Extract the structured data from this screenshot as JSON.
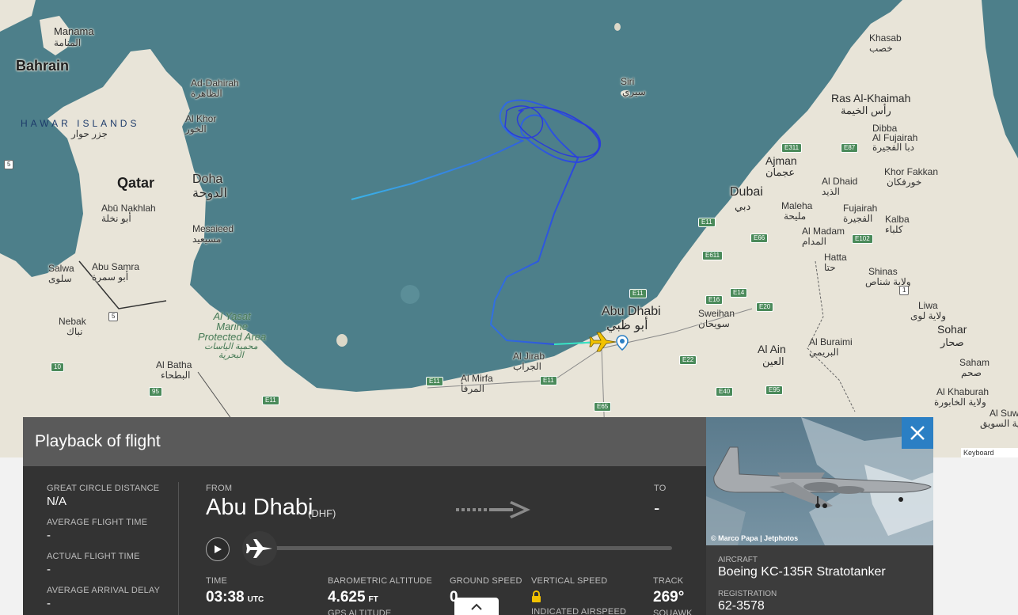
{
  "map": {
    "labels": {
      "manama": "Manama",
      "manama_ar": "المنامة",
      "bahrain": "Bahrain",
      "hawar": "HAWAR ISLANDS",
      "hawar_ar": "جزر حوار",
      "ad_dahirah": "Ad-Dahirah",
      "ad_dahirah_ar": "الظاهرة",
      "al_khor": "Al Khor",
      "al_khor_ar": "الخور",
      "qatar": "Qatar",
      "doha": "Doha",
      "doha_ar": "الدوحة",
      "abu_nakhlah": "Abū Nakhlah",
      "abu_nakhlah_ar": "أبو نخلة",
      "mesaieed": "Mesaieed",
      "mesaieed_ar": "مسيعيد",
      "salwa": "Salwa",
      "salwa_ar": "سلوى",
      "abu_samra": "Abu Samra",
      "abu_samra_ar": "أبو سمرة",
      "nebak": "Nebak",
      "nebak_ar": "نباك",
      "al_yasat": "Al Yasat\nMarine\nProtected Area",
      "al_yasat_ar": "محمية الياسات\nالبحرية",
      "al_batha": "Al Batha",
      "al_batha_ar": "البطحاء",
      "siri": "Siri",
      "siri_ar": "سيري",
      "khasab": "Khasab",
      "khasab_ar": "خصب",
      "ras_al_khaimah": "Ras Al-Khaimah",
      "ras_al_khaimah_ar": "رأس الخيمة",
      "dibba": "Dibba",
      "dibba_ar": "دبا",
      "al_fujairah": "Al Fujairah",
      "al_fujairah_ar": "دبا الفجيرة",
      "ajman": "Ajman",
      "ajman_ar": "عجمان",
      "khor_fakkan": "Khor Fakkan",
      "khor_fakkan_ar": "خورفكان",
      "dubai": "Dubai",
      "dubai_ar": "دبي",
      "al_dhaid": "Al Dhaid",
      "al_dhaid_ar": "الذيد",
      "maleha": "Maleha",
      "maleha_ar": "مليحة",
      "fujairah": "Fujairah",
      "fujairah_ar": "الفجيرة",
      "kalba": "Kalba",
      "kalba_ar": "كلباء",
      "al_madam": "Al Madam",
      "al_madam_ar": "المدام",
      "hatta": "Hatta",
      "hatta_ar": "حتا",
      "shinas": "Shinas",
      "shinas_ar": "ولاية شناص",
      "abu_dhabi": "Abu Dhabi",
      "abu_dhabi_ar": "أبو ظبي",
      "sweihan": "Sweihan",
      "sweihan_ar": "سويحان",
      "liwa": "Liwa",
      "liwa_ar": "ولاية لوى",
      "sohar": "Sohar",
      "sohar_ar": "صحار",
      "al_ain": "Al Ain",
      "al_ain_ar": "العين",
      "al_buraimi": "Al Buraimi",
      "al_buraimi_ar": "البريمي",
      "saham": "Saham",
      "saham_ar": "صحم",
      "al_jirab": "Al Jirab",
      "al_jirab_ar": "الجراب",
      "al_mirfa": "Al Mirfa",
      "al_mirfa_ar": "المرفأ",
      "al_khaburah": "Al Khaburah",
      "al_khaburah_ar": "ولاية الخابورة",
      "al_suw": "Al Suw",
      "al_suw_ar": "ولاية السويق"
    },
    "roads": {
      "r5a": "5",
      "r5b": "5",
      "r10": "10",
      "r95": "95",
      "e11a": "E11",
      "e11b": "E11",
      "e11c": "E11",
      "e11d": "E11",
      "e11e": "E11",
      "e311": "E311",
      "e87": "E87",
      "e611": "E611",
      "e66": "E66",
      "e16": "E16",
      "e14": "E14",
      "e20": "E20",
      "e22": "E22",
      "e40": "E40",
      "e95": "E95",
      "e65": "E65",
      "e102": "E102",
      "r1": "1"
    },
    "keyboard_shortcuts": "Keyboard shortcuts"
  },
  "panel": {
    "title": "Playback of flight",
    "stats": [
      {
        "label": "GREAT CIRCLE DISTANCE",
        "value": "N/A"
      },
      {
        "label": "AVERAGE FLIGHT TIME",
        "value": "-"
      },
      {
        "label": "ACTUAL FLIGHT TIME",
        "value": "-"
      },
      {
        "label": "AVERAGE ARRIVAL DELAY",
        "value": "-"
      }
    ],
    "from_label": "FROM",
    "from_city": "Abu Dhabi",
    "from_code": "(DHF)",
    "to_label": "TO",
    "to_value": "-",
    "time_label": "TIME",
    "time_value": "03:38",
    "time_unit": "UTC",
    "baro_label": "BAROMETRIC ALTITUDE",
    "baro_value": "4.625",
    "baro_unit": "FT",
    "gps_label": "GPS ALTITUDE",
    "ground_speed_label": "GROUND SPEED",
    "ground_speed_value": "0",
    "vertical_speed_label": "VERTICAL SPEED",
    "indicated_airspeed_label": "INDICATED AIRSPEED",
    "track_label": "TRACK",
    "track_value": "269°",
    "squawk_label": "SQUAWK",
    "playback_progress": 0.0
  },
  "photo": {
    "credit": "© Marco Papa | Jetphotos",
    "aircraft_label": "AIRCRAFT",
    "aircraft_value": "Boeing KC-135R Stratotanker",
    "registration_label": "REGISTRATION",
    "registration_value": "62-3578"
  },
  "colors": {
    "sea": "#4d7f8a",
    "land": "#e8e4d8",
    "track_blue": "#2a3bdc",
    "track_light": "#3ab4e8",
    "close_button": "#2b7fc4",
    "aircraft_yellow": "#f2c200"
  }
}
